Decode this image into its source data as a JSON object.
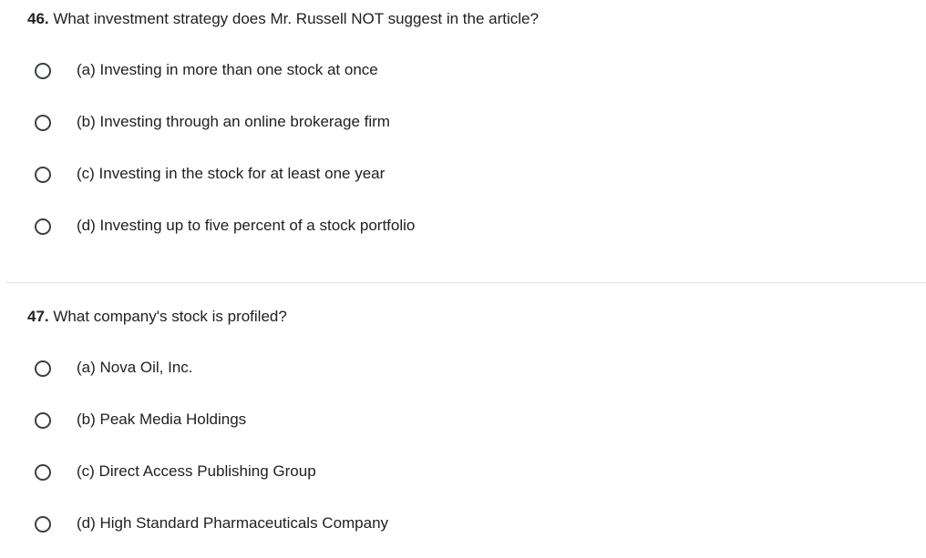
{
  "questions": [
    {
      "number": "46.",
      "text": " What investment strategy does Mr. Russell NOT suggest in the article?",
      "options": [
        {
          "label": "(a) Investing in more than one stock at once"
        },
        {
          "label": "(b) Investing through an online brokerage firm"
        },
        {
          "label": "(c) Investing in the stock for at least one year"
        },
        {
          "label": "(d) Investing up to five percent of a stock portfolio"
        }
      ]
    },
    {
      "number": "47.",
      "text": " What company's stock is profiled?",
      "options": [
        {
          "label": "(a) Nova Oil, Inc."
        },
        {
          "label": "(b) Peak Media Holdings"
        },
        {
          "label": "(c) Direct Access Publishing Group"
        },
        {
          "label": "(d) High Standard Pharmaceuticals Company"
        }
      ]
    }
  ]
}
